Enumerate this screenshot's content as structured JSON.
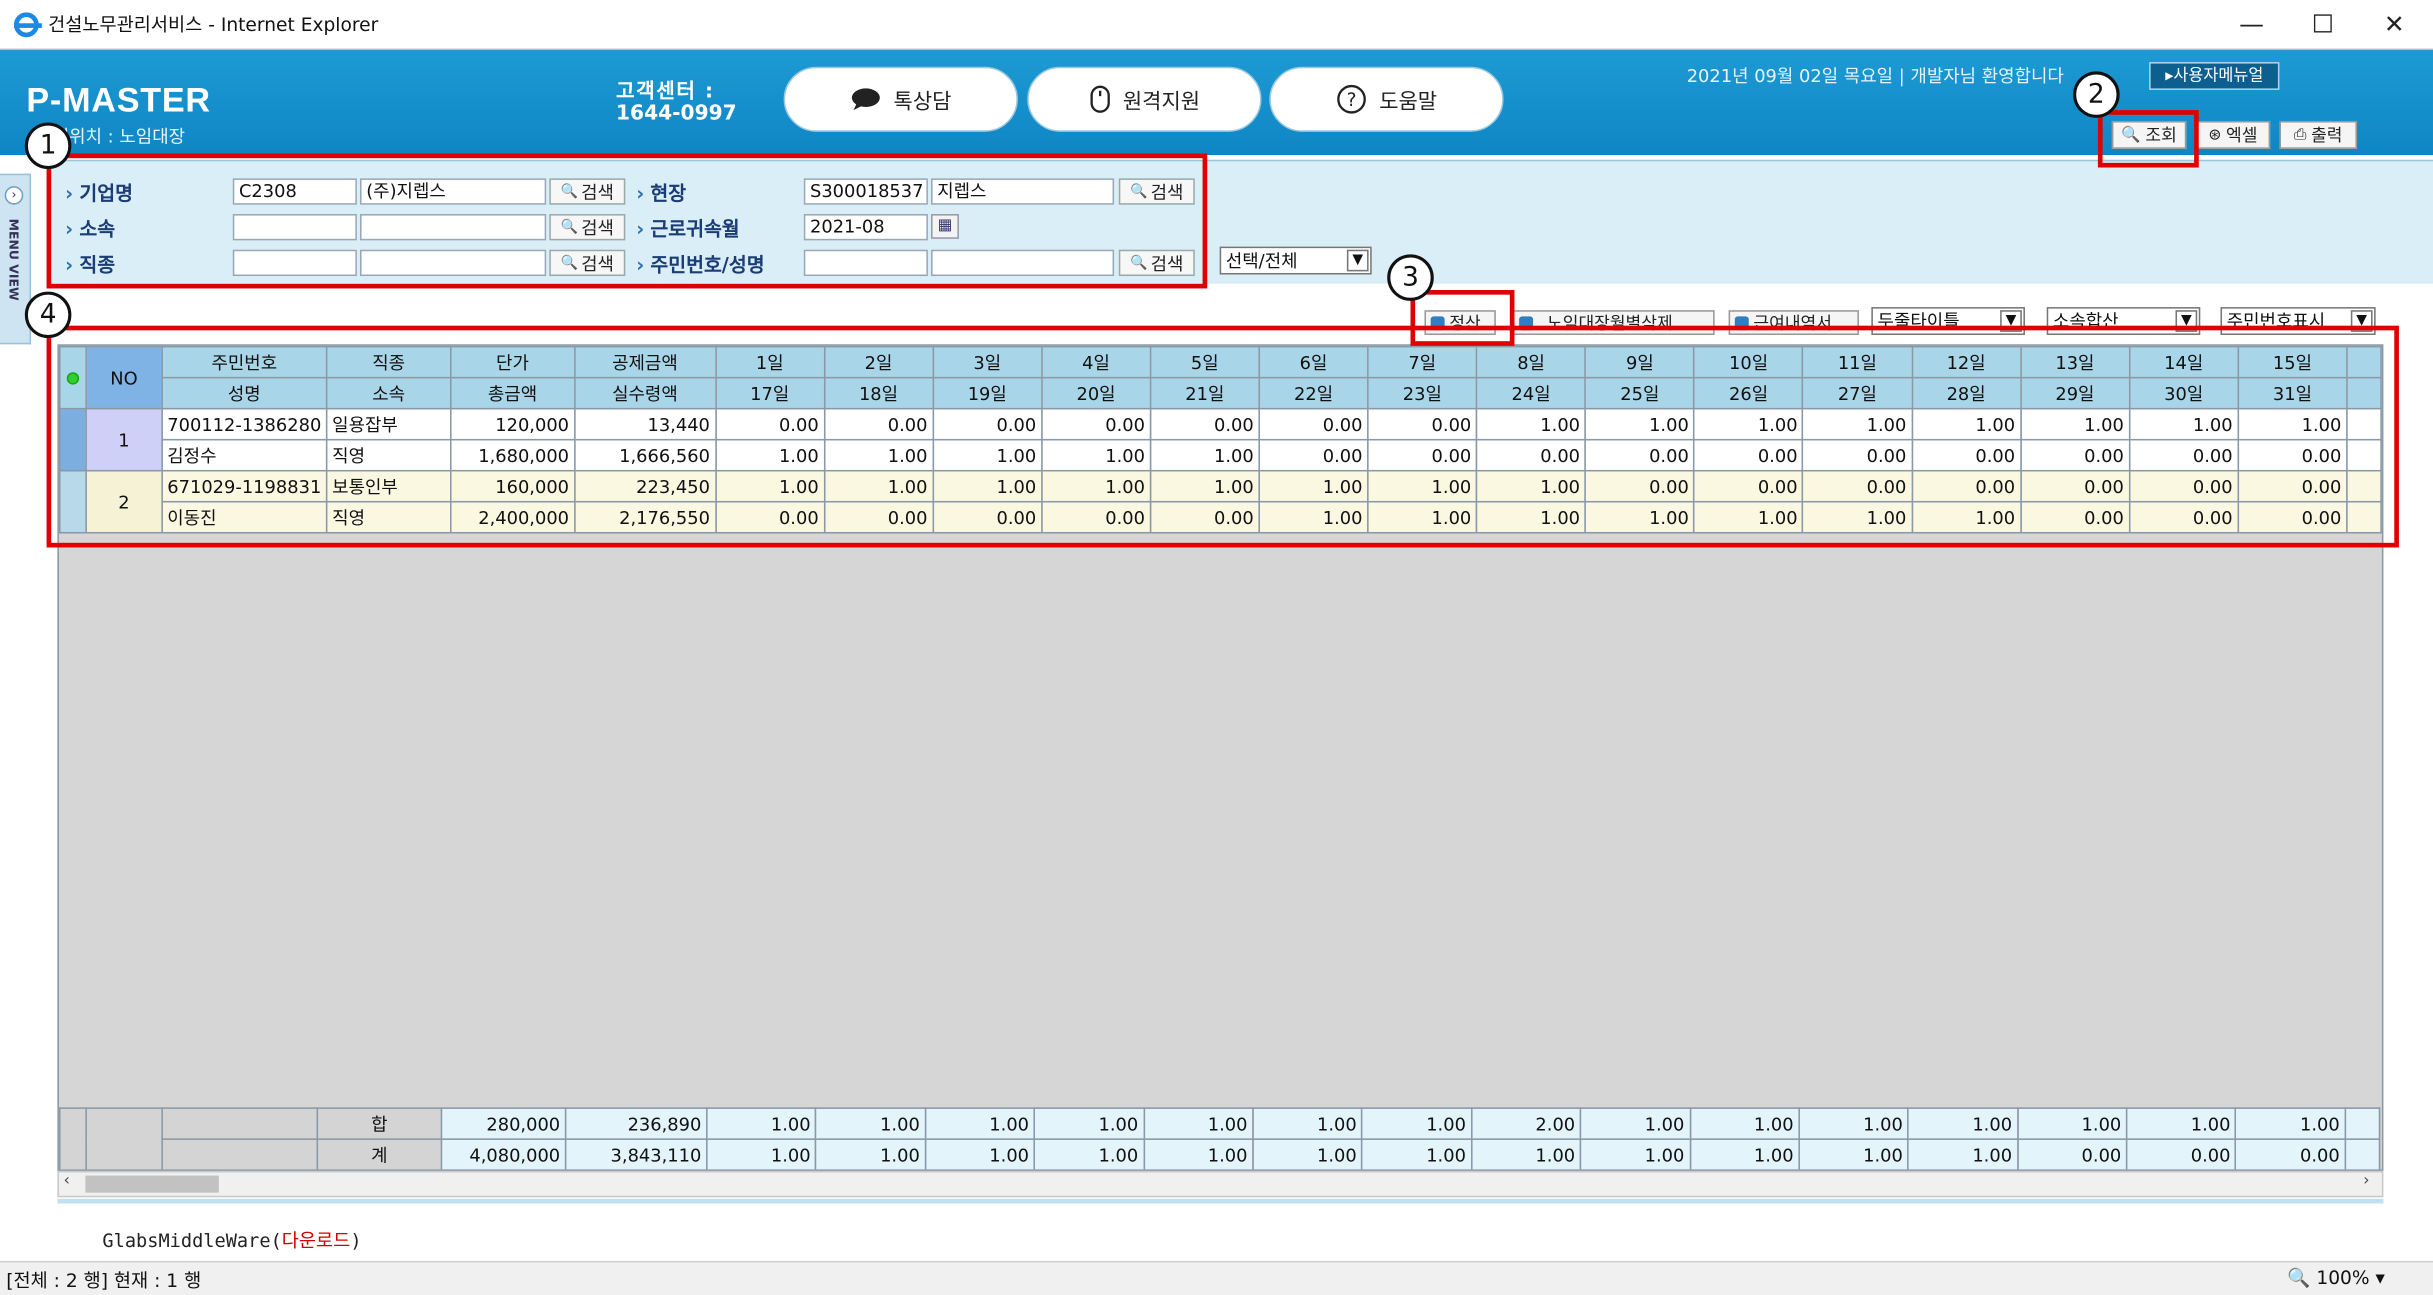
{
  "window": {
    "title": "건설노무관리서비스 - Internet Explorer",
    "minimize": "—",
    "maximize": "☐",
    "close": "✕"
  },
  "header": {
    "logo": "P-MASTER",
    "location": "현위치 : 노임대장",
    "cc_label": "고객센터 :",
    "cc_phone": "1644-0997",
    "btn_chat": "톡상담",
    "btn_remote": "원격지원",
    "btn_help": "도움말",
    "userinfo": "2021년 09월 02일 목요일 | 개발자님 환영합니다",
    "manual": "▸사용자메뉴얼",
    "btn_search": "조회",
    "btn_excel": "엑셀",
    "btn_print": "출력"
  },
  "sidetab": {
    "arrow": "›",
    "label": "MENU VIEW"
  },
  "search": {
    "company_label": "기업명",
    "company_code": "C2308",
    "company_name": "(주)지렙스",
    "site_label": "현장",
    "site_code": "S300018537",
    "site_name": "지렙스",
    "dept_label": "소속",
    "dept_code": "",
    "dept_name": "",
    "month_label": "근로귀속월",
    "month_value": "2021-08",
    "job_label": "직종",
    "job_code": "",
    "job_name": "",
    "id_label": "주민번호/성명",
    "id_value1": "",
    "id_value2": "",
    "search_btn": "검색",
    "select_all": "선택/전체"
  },
  "toolbar": {
    "settle": "정산",
    "delete_by_month": "노임대장월별삭제",
    "details": "근여내역서",
    "sel1": "두줄타이틀",
    "sel2": "소속합산",
    "sel3": "주민번호표시"
  },
  "grid": {
    "h1": [
      "NO",
      "주민번호",
      "직종",
      "단가",
      "공제금액",
      "1일",
      "2일",
      "3일",
      "4일",
      "5일",
      "6일",
      "7일",
      "8일",
      "9일",
      "10일",
      "11일",
      "12일",
      "13일",
      "14일",
      "15일"
    ],
    "h2": [
      "성명",
      "소속",
      "총금액",
      "실수령액",
      "17일",
      "18일",
      "19일",
      "20일",
      "21일",
      "22일",
      "23일",
      "24일",
      "25일",
      "26일",
      "27일",
      "28일",
      "29일",
      "30일",
      "31일"
    ],
    "rows": [
      {
        "no": "1",
        "a": [
          "700112-1386280",
          "일용잡부",
          "120,000",
          "13,440",
          "0.00",
          "0.00",
          "0.00",
          "0.00",
          "0.00",
          "0.00",
          "0.00",
          "1.00",
          "1.00",
          "1.00",
          "1.00",
          "1.00",
          "1.00",
          "1.00",
          "1.00"
        ],
        "b": [
          "김정수",
          "직영",
          "1,680,000",
          "1,666,560",
          "1.00",
          "1.00",
          "1.00",
          "1.00",
          "1.00",
          "0.00",
          "0.00",
          "0.00",
          "0.00",
          "0.00",
          "0.00",
          "0.00",
          "0.00",
          "0.00",
          "0.00"
        ]
      },
      {
        "no": "2",
        "a": [
          "671029-1198831",
          "보통인부",
          "160,000",
          "223,450",
          "1.00",
          "1.00",
          "1.00",
          "1.00",
          "1.00",
          "1.00",
          "1.00",
          "1.00",
          "0.00",
          "0.00",
          "0.00",
          "0.00",
          "0.00",
          "0.00",
          "0.00"
        ],
        "b": [
          "이동진",
          "직영",
          "2,400,000",
          "2,176,550",
          "0.00",
          "0.00",
          "0.00",
          "0.00",
          "0.00",
          "1.00",
          "1.00",
          "1.00",
          "1.00",
          "1.00",
          "1.00",
          "1.00",
          "0.00",
          "0.00",
          "0.00"
        ]
      }
    ],
    "sum1": [
      "합",
      "280,000",
      "236,890",
      "1.00",
      "1.00",
      "1.00",
      "1.00",
      "1.00",
      "1.00",
      "1.00",
      "2.00",
      "1.00",
      "1.00",
      "1.00",
      "1.00",
      "1.00",
      "1.00",
      "1.00"
    ],
    "sum2": [
      "계",
      "4,080,000",
      "3,843,110",
      "1.00",
      "1.00",
      "1.00",
      "1.00",
      "1.00",
      "1.00",
      "1.00",
      "1.00",
      "1.00",
      "1.00",
      "1.00",
      "1.00",
      "0.00",
      "0.00",
      "0.00"
    ]
  },
  "footer": {
    "middleware": "GlabsMiddleWare(",
    "download": "다운로드",
    "close_paren": ")"
  },
  "status": {
    "text": "[전체 : 2 행] 현재 : 1 행",
    "zoom": "100%"
  },
  "annotations": {
    "n1": "1",
    "n2": "2",
    "n3": "3",
    "n4": "4"
  }
}
